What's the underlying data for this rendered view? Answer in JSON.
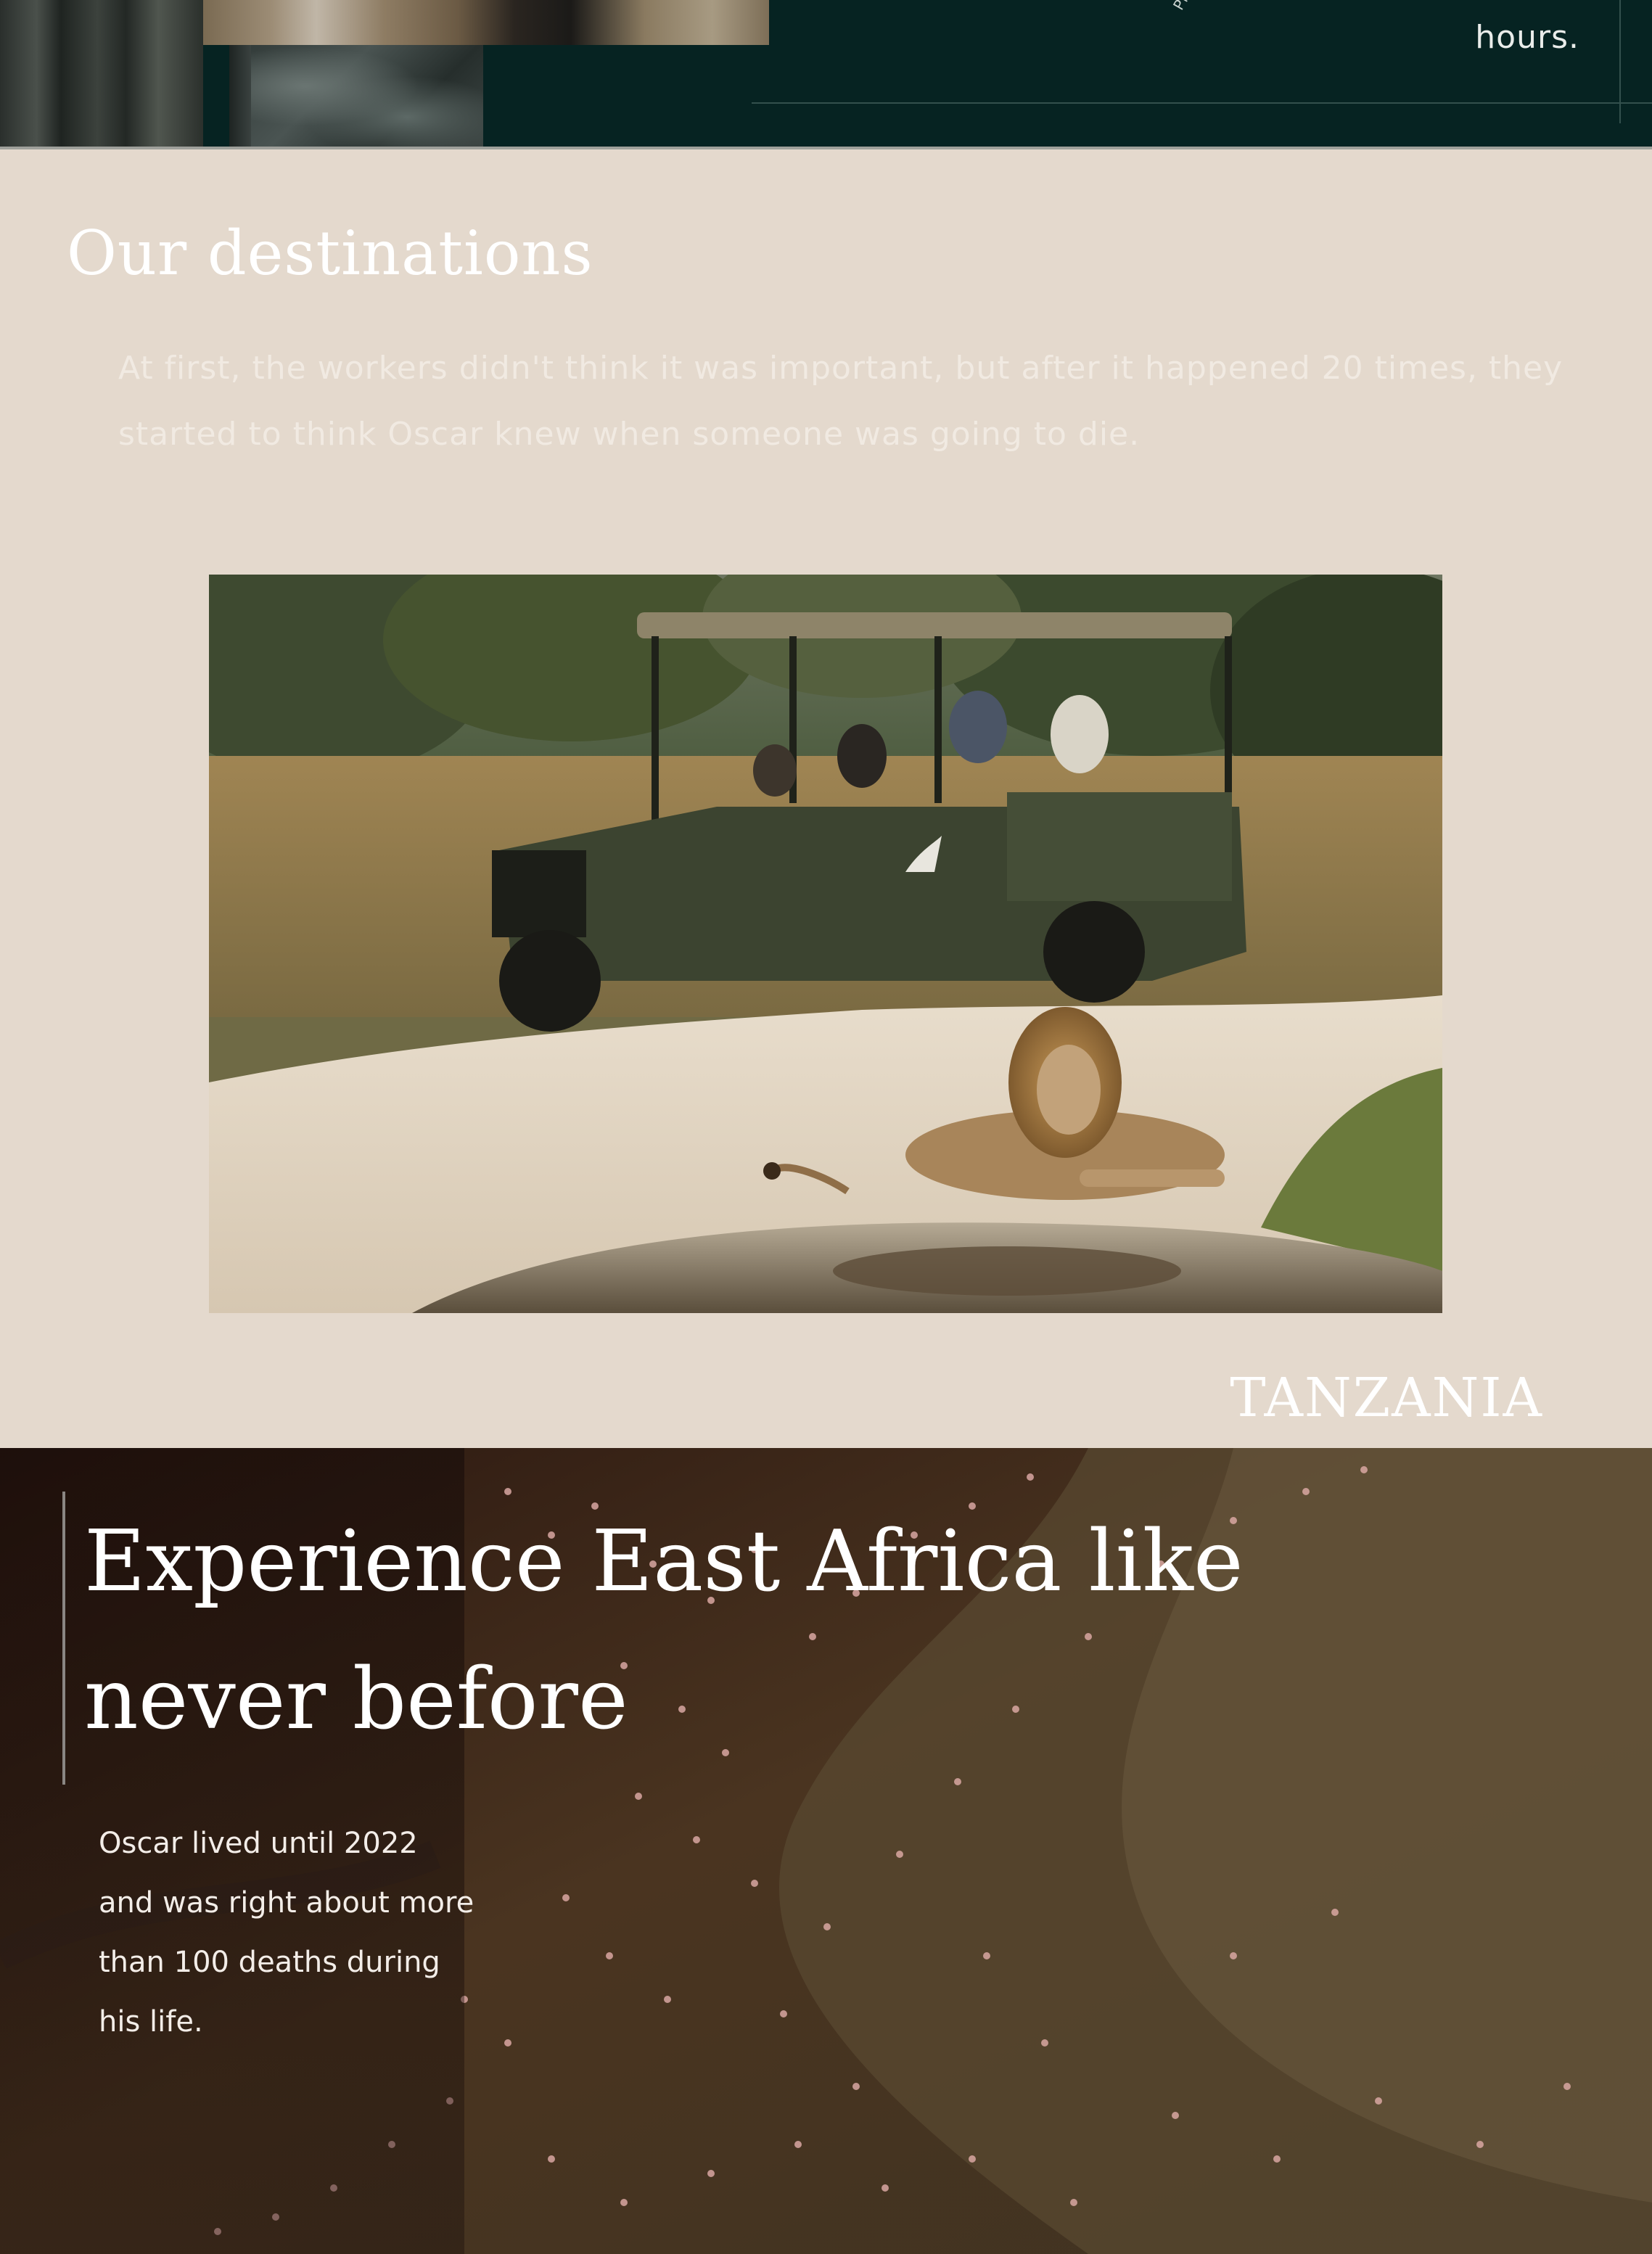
{
  "top_band": {
    "hours_text": "hours.",
    "photo_credit": "Photo"
  },
  "destinations": {
    "title": "Our destinations",
    "intro": "At first, the workers didn't think it was important, but after it happened 20 times, they started to think Oscar knew when someone was going to die.",
    "hero_image_alt": "Safari vehicle with guests watching a lion resting by a waterhole",
    "country_label": "TANZANIA"
  },
  "experience": {
    "heading": "Experience East Africa like never before",
    "body": "Oscar lived until 2022 and was right about more than 100 deaths during his life.",
    "background_alt": "Aerial view of flamingos over a lake shore"
  },
  "colors": {
    "dark_band": "#062322",
    "section_bg": "#e4d9cd",
    "text_light": "#ffffff"
  }
}
